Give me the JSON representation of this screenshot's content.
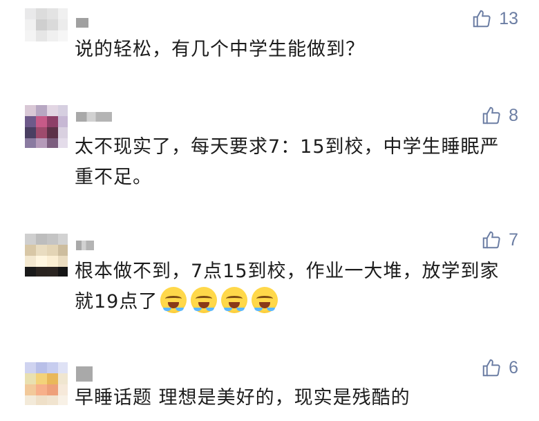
{
  "comments": [
    {
      "text": "说的轻松，有几个中学生能做到？",
      "likes": "13"
    },
    {
      "text": "太不现实了，每天要求7：15到校，中学生睡眠严重不足。",
      "likes": "8"
    },
    {
      "text": "根本做不到，7点15到校，作业一大堆，放学到家就19点了",
      "emoji_icons": [
        "crying-face-icon",
        "crying-face-icon",
        "crying-face-icon",
        "crying-face-icon"
      ],
      "likes": "7"
    },
    {
      "text": "早睡话题 理想是美好的，现实是残酷的",
      "likes": "6"
    }
  ],
  "colors": {
    "like": "#6b7da3",
    "text": "#1c1c1c",
    "background": "#ffffff"
  },
  "icons": {
    "like": "thumbs-up-icon",
    "emoji": "crying-face-icon"
  }
}
